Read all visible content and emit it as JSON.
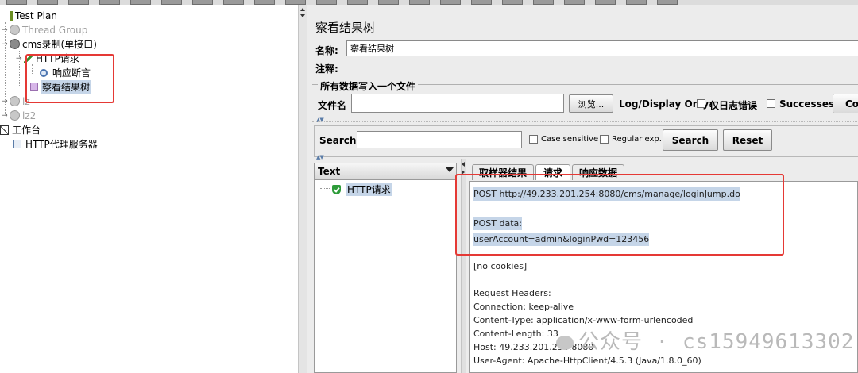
{
  "toolbar": {
    "button_count": 22
  },
  "tree": {
    "items": [
      {
        "label": "Test Plan",
        "icon": "testplan-icon"
      },
      {
        "label": "Thread Group",
        "icon": "gear-icon",
        "disabled": true
      },
      {
        "label": "cms录制(单接口)",
        "icon": "gear-icon"
      },
      {
        "label": "HTTP请求",
        "icon": "pipette-icon"
      },
      {
        "label": "响应断言",
        "icon": "magnifier-icon"
      },
      {
        "label": "察看结果树",
        "icon": "results-tree-icon",
        "selected": true
      },
      {
        "label": "lz",
        "icon": "gear-icon",
        "disabled": true
      },
      {
        "label": "lz2",
        "icon": "gear-icon",
        "disabled": true
      },
      {
        "label": "工作台",
        "icon": "workbench-icon"
      },
      {
        "label": "HTTP代理服务器",
        "icon": "proxy-icon"
      }
    ]
  },
  "panel": {
    "title": "察看结果树",
    "name_label": "名称:",
    "name_value": "察看结果树",
    "comment_label": "注释:",
    "comment_value": "",
    "file_group_legend": "所有数据写入一个文件",
    "filename_label": "文件名",
    "filename_value": "",
    "browse_label": "浏览...",
    "log_display_label": "Log/Display Only:",
    "errors_only_label": "仅日志错误",
    "successes_label": "Successes",
    "configure_label": "Co"
  },
  "search": {
    "label": "Search:",
    "value": "",
    "case_sensitive_label": "Case sensitive",
    "regex_label": "Regular exp.",
    "search_button": "Search",
    "reset_button": "Reset"
  },
  "results": {
    "renderer": "Text",
    "samples": [
      {
        "label": "HTTP请求",
        "status": "success"
      }
    ],
    "tabs": [
      {
        "label": "取样器结果"
      },
      {
        "label": "请求",
        "active": true
      },
      {
        "label": "响应数据"
      }
    ],
    "request_lines": [
      "POST http://49.233.201.254:8080/cms/manage/loginJump.do",
      "",
      "POST data:",
      "userAccount=admin&loginPwd=123456",
      "",
      "[no cookies]",
      "",
      "Request Headers:",
      "Connection: keep-alive",
      "Content-Type: application/x-www-form-urlencoded",
      "Content-Length: 33",
      "Host: 49.233.201.254:8080",
      "User-Agent: Apache-HttpClient/4.5.3 (Java/1.8.0_60)"
    ]
  },
  "watermark": "公众号 · cs15949613302",
  "colors": {
    "highlight": "#e53935",
    "selection": "#c5d5e8",
    "panel_bg": "#ececec"
  }
}
